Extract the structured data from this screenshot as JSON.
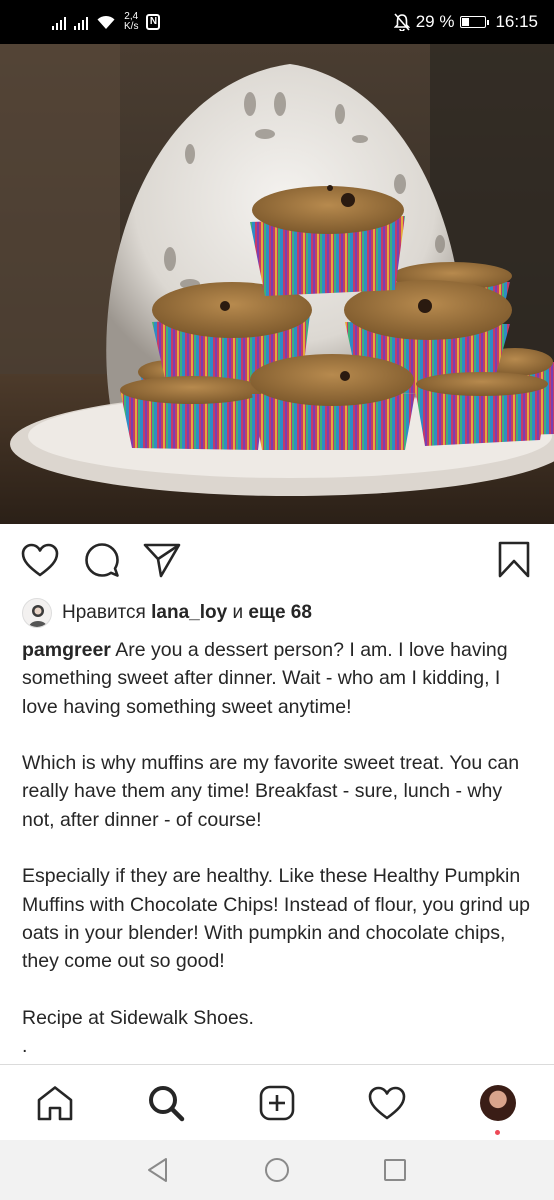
{
  "status_bar": {
    "speed_value": "2,4",
    "speed_unit": "K/s",
    "nfc_label": "N",
    "battery_percent": "29 %",
    "battery_level": 0.29,
    "time": "16:15"
  },
  "post": {
    "likes": {
      "prefix": "Нравится",
      "user": "lana_loy",
      "conjunction": "и",
      "others": "еще 68"
    },
    "caption": {
      "username": "pamgreer",
      "first_line": "Are you a dessert person?  I am.  I love having something sweet after dinner.  Wait - who am I kidding, I love having something sweet anytime!",
      "paragraph_2": "Which is why muffins are my favorite sweet treat.  You can really have them any time!  Breakfast - sure, lunch - why not, after dinner - of course!",
      "paragraph_3": "Especially if they are healthy.  Like these Healthy Pumpkin Muffins with Chocolate Chips!  Instead of flour, you grind up oats in your blender!  With pumpkin and chocolate chips, they come out so good!",
      "paragraph_4": "Recipe at Sidewalk Shoes.",
      "trailing": "."
    },
    "icons": [
      "heart-icon",
      "comment-icon",
      "share-icon",
      "bookmark-icon"
    ]
  },
  "tab_bar": {
    "icons": [
      "home-icon",
      "search-icon",
      "new-post-icon",
      "activity-icon",
      "profile-avatar"
    ]
  },
  "colors": {
    "notification_dot": "#ed4956",
    "status_bar_bg": "#000000",
    "text": "#262626"
  }
}
